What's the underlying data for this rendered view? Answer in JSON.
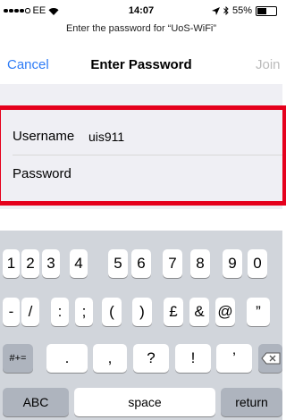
{
  "status_bar": {
    "carrier": "EE",
    "time": "14:07",
    "battery": "55%",
    "battery_level": 0.55
  },
  "prompt": "Enter the password for “UoS-WiFi”",
  "nav": {
    "cancel": "Cancel",
    "title": "Enter Password",
    "join": "Join"
  },
  "form": {
    "username_label": "Username",
    "username_value": "uis911",
    "password_label": "Password",
    "password_value": ""
  },
  "keyboard": {
    "row1": [
      "1",
      "2",
      "3",
      "4",
      "5",
      "6",
      "7",
      "8",
      "9",
      "0"
    ],
    "row2": [
      "-",
      "/",
      ":",
      ";",
      "(",
      ")",
      "£",
      "&",
      "@",
      "”"
    ],
    "row3": [
      ".",
      ",",
      "?",
      "!",
      "’"
    ],
    "mode_key": "#+=",
    "abc_key": "ABC",
    "space_key": "space",
    "return_key": "return"
  }
}
